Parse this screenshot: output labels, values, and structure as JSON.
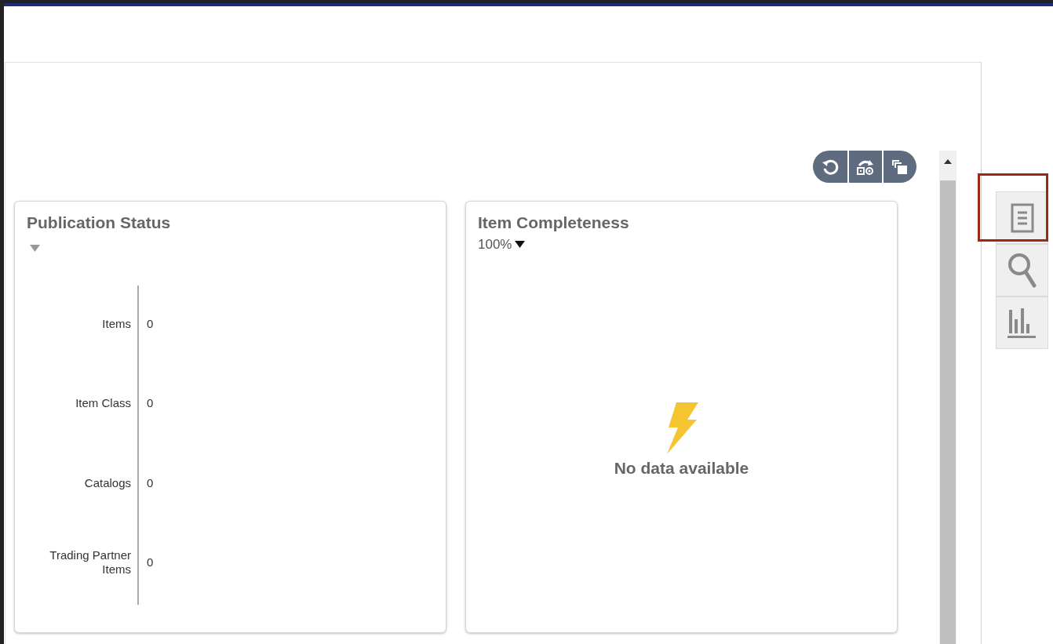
{
  "toolbar": {
    "buttons": [
      {
        "kind": "refresh"
      },
      {
        "kind": "swap"
      },
      {
        "kind": "copy"
      }
    ]
  },
  "cards": [
    {
      "title": "Publication Status",
      "kind": "chart",
      "rows": [
        {
          "label": "Items",
          "value": "0"
        },
        {
          "label": "Item Class",
          "value": "0"
        },
        {
          "label": "Catalogs",
          "value": "0"
        },
        {
          "label": "Trading Partner Items",
          "value": "0"
        }
      ]
    },
    {
      "title": "Item Completeness",
      "kind": "empty",
      "filter": "100%",
      "message": "No data available"
    }
  ],
  "side_tabs": [
    {
      "kind": "document",
      "highlighted": true
    },
    {
      "kind": "search",
      "highlighted": false
    },
    {
      "kind": "chart",
      "highlighted": false
    }
  ]
}
